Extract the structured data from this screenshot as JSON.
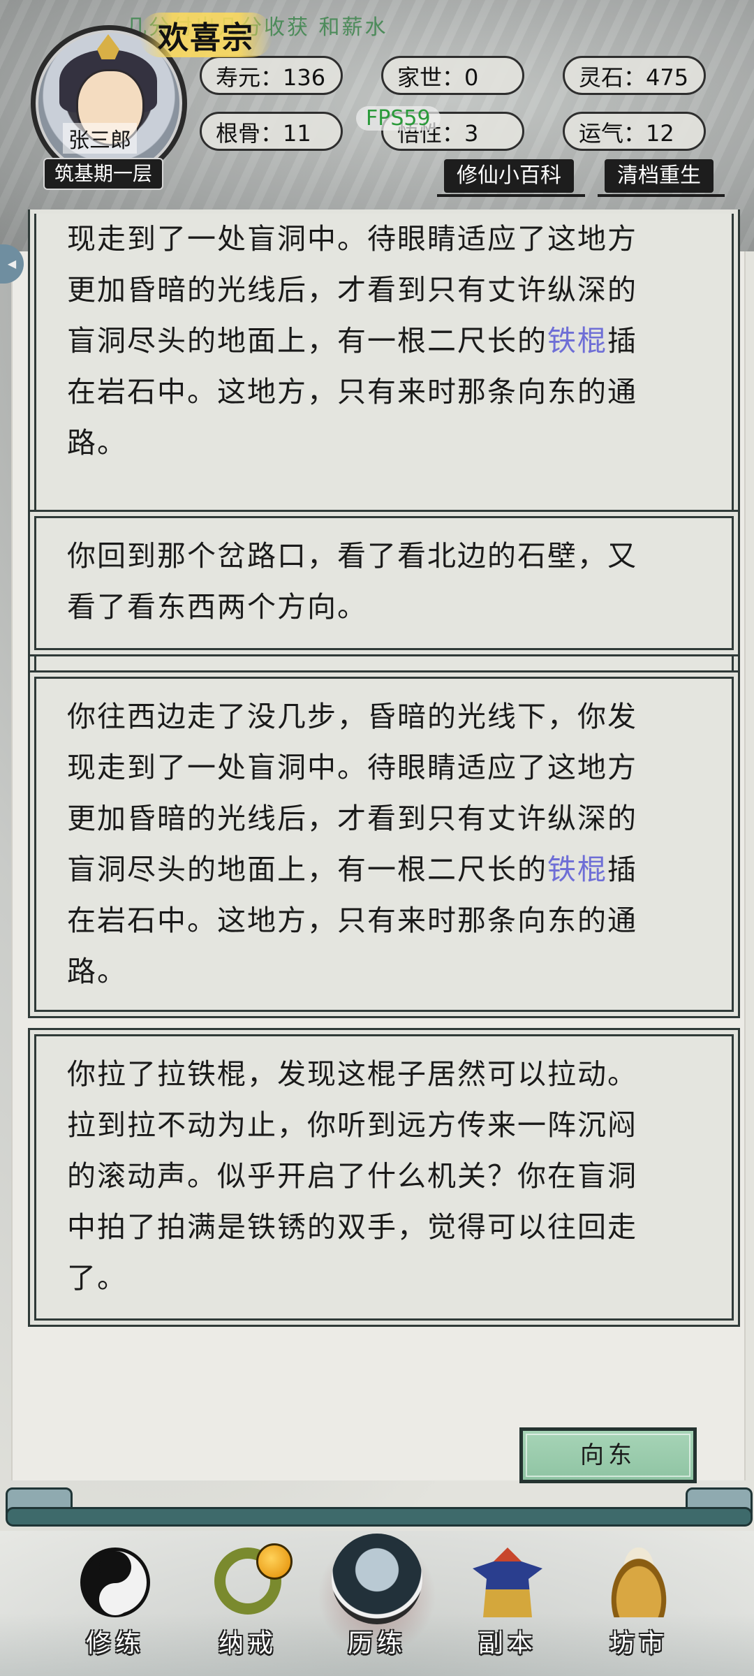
{
  "header": {
    "ticker_text": "几分付出几分收获 和薪水",
    "sect_name": "欢喜宗",
    "avatar_name": "张三郎",
    "realm": "筑基期一层",
    "fps": "FPS59",
    "stats": [
      {
        "label": "寿元：136"
      },
      {
        "label": "家世：0"
      },
      {
        "label": "灵石：475"
      },
      {
        "label": "根骨：11"
      },
      {
        "label": "悟性：3"
      },
      {
        "label": "运气：12"
      }
    ],
    "encyclopedia_label": "修仙小百科",
    "reset_label": "清档重生",
    "side_tab_text": "◀"
  },
  "story": {
    "card1": {
      "line1": "现走到了一处盲洞中。待眼睛适应了这地方",
      "line2": "更加昏暗的光线后，才看到只有丈许纵深的",
      "line3_pre": "盲洞尽头的地面上，有一根二尺长的",
      "line3_hl": "铁棍",
      "line3_post": "插",
      "line4": "在岩石中。这地方，只有来时那条向东的通",
      "line5": "路。"
    },
    "card2": {
      "line1": "你回到那个岔路口，看了看北边的石壁，又",
      "line2": "看了看东西两个方向。"
    },
    "card3": {
      "line1": "你往西边走了没几步，昏暗的光线下，你发",
      "line2": "现走到了一处盲洞中。待眼睛适应了这地方",
      "line3": "更加昏暗的光线后，才看到只有丈许纵深的",
      "line4_pre": "盲洞尽头的地面上，有一根二尺长的",
      "line4_hl": "铁棍",
      "line4_post": "插",
      "line5": "在岩石中。这地方，只有来时那条向东的通",
      "line6": "路。"
    },
    "card4": {
      "line1": "你拉了拉铁棍，发现这棍子居然可以拉动。",
      "line2": "拉到拉不动为止，你听到远方传来一阵沉闷",
      "line3": "的滚动声。似乎开启了什么机关？你在盲洞",
      "line4": "中拍了拍满是铁锈的双手，觉得可以往回走",
      "line5": "了。"
    },
    "highlight_color": "#6e6ed6"
  },
  "actions": {
    "east_button": "向东"
  },
  "nav": {
    "items": [
      {
        "label": "修练",
        "icon": "yin-yang-icon"
      },
      {
        "label": "纳戒",
        "icon": "storage-ring-icon"
      },
      {
        "label": "历练",
        "icon": "cloud-journey-icon"
      },
      {
        "label": "副本",
        "icon": "pagoda-icon"
      },
      {
        "label": "坊市",
        "icon": "cauldron-icon"
      }
    ],
    "active": "历练"
  }
}
